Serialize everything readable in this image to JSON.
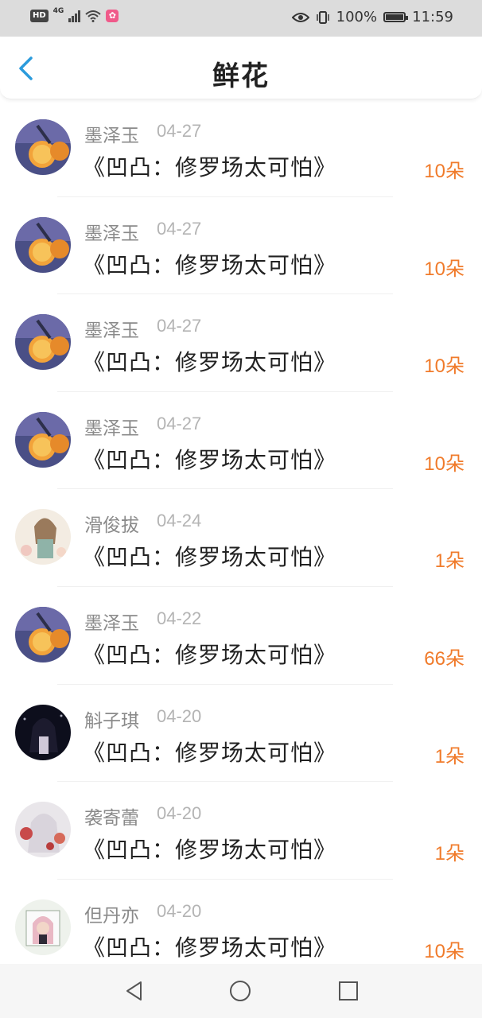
{
  "status_bar": {
    "hd": "HD",
    "network": "4G",
    "battery_percent": "100%",
    "time": "11:59",
    "icons": [
      "hd-icon",
      "signal-icon",
      "wifi-icon",
      "app-icon",
      "eye-icon",
      "vibrate-icon",
      "battery-icon"
    ]
  },
  "header": {
    "title": "鲜花",
    "back_icon": "chevron-left-icon",
    "accent_color": "#2b9bdc"
  },
  "records": [
    {
      "name": "墨泽玉",
      "date": "04-27",
      "book": "《凹凸：修罗场太可怕》",
      "amount": "10朵",
      "avatar": "avatar-orange-lemon"
    },
    {
      "name": "墨泽玉",
      "date": "04-27",
      "book": "《凹凸：修罗场太可怕》",
      "amount": "10朵",
      "avatar": "avatar-orange-lemon"
    },
    {
      "name": "墨泽玉",
      "date": "04-27",
      "book": "《凹凸：修罗场太可怕》",
      "amount": "10朵",
      "avatar": "avatar-orange-lemon"
    },
    {
      "name": "墨泽玉",
      "date": "04-27",
      "book": "《凹凸：修罗场太可怕》",
      "amount": "10朵",
      "avatar": "avatar-orange-lemon"
    },
    {
      "name": "滑俊拔",
      "date": "04-24",
      "book": "《凹凸：修罗场太可怕》",
      "amount": "1朵",
      "avatar": "avatar-anime-girl-light"
    },
    {
      "name": "墨泽玉",
      "date": "04-22",
      "book": "《凹凸：修罗场太可怕》",
      "amount": "66朵",
      "avatar": "avatar-orange-lemon"
    },
    {
      "name": "斛子琪",
      "date": "04-20",
      "book": "《凹凸：修罗场太可怕》",
      "amount": "1朵",
      "avatar": "avatar-anime-girl-dark"
    },
    {
      "name": "袭寄蕾",
      "date": "04-20",
      "book": "《凹凸：修罗场太可怕》",
      "amount": "1朵",
      "avatar": "avatar-anime-flowers"
    },
    {
      "name": "但丹亦",
      "date": "04-20",
      "book": "《凹凸：修罗场太可怕》",
      "amount": "10朵",
      "avatar": "avatar-girl-pink-hood"
    }
  ],
  "colors": {
    "amount": "#f07b2b",
    "name": "#8a8a8a",
    "date": "#b4b4b4",
    "book": "#222222"
  },
  "nav_bar": {
    "icons": [
      "back-triangle-icon",
      "home-circle-icon",
      "recents-square-icon"
    ]
  }
}
